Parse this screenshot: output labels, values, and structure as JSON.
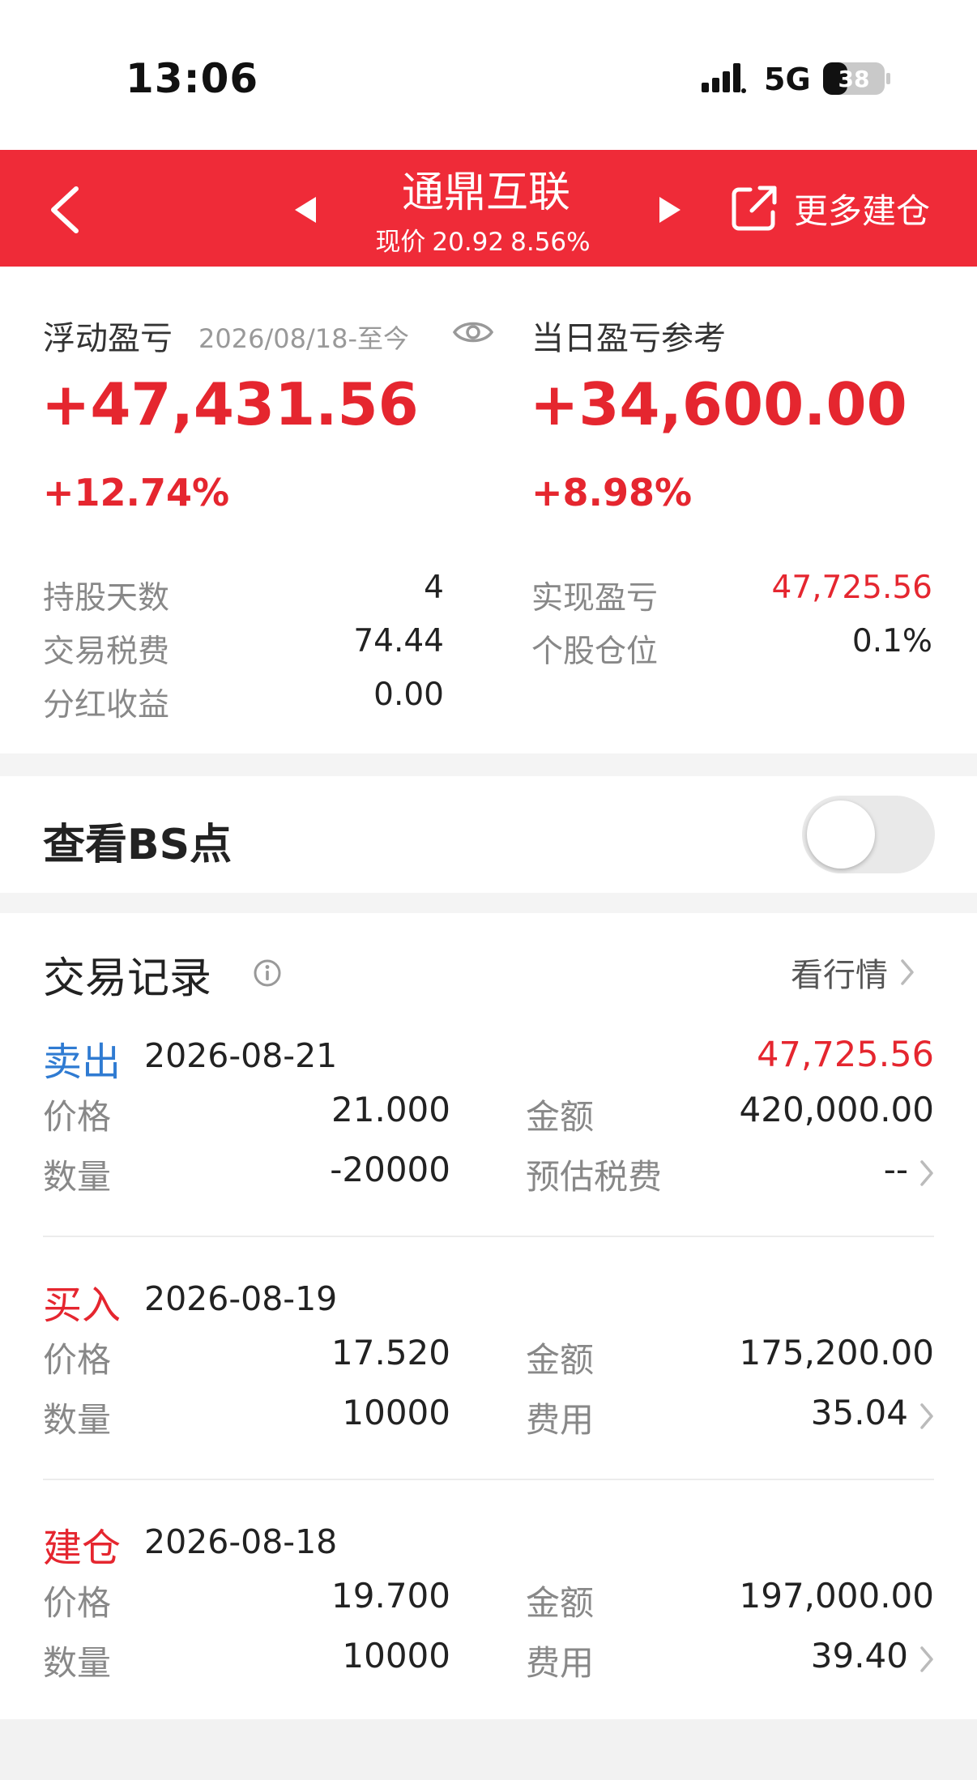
{
  "status_bar": {
    "time": "13:06",
    "network": "5G",
    "battery": "38"
  },
  "header": {
    "title": "通鼎互联",
    "price_label": "现价",
    "price": "20.92",
    "change_pct": "8.56%",
    "more_build_label": "更多建仓",
    "color": "#ef2b38"
  },
  "summary": {
    "floating": {
      "label": "浮动盈亏",
      "date_range": "2026/08/18-至今",
      "amount": "+47,431.56",
      "pct": "+12.74%"
    },
    "daily": {
      "label": "当日盈亏参考",
      "amount": "+34,600.00",
      "pct": "+8.98%"
    },
    "left_items": [
      {
        "label": "持股天数",
        "value": "4"
      },
      {
        "label": "交易税费",
        "value": "74.44"
      },
      {
        "label": "分红收益",
        "value": "0.00"
      }
    ],
    "right_items": [
      {
        "label": "实现盈亏",
        "value": "47,725.56"
      },
      {
        "label": "个股仓位",
        "value": "0.1%"
      }
    ]
  },
  "bs": {
    "label": "查看BS点",
    "enabled": false
  },
  "records": {
    "title": "交易记录",
    "view_market_label": "看行情",
    "items": [
      {
        "type": "卖出",
        "type_color": "#2f7bd2",
        "date": "2026-08-21",
        "profit": "47,725.56",
        "price_label": "价格",
        "price": "21.000",
        "amount_label": "金额",
        "amount": "420,000.00",
        "qty_label": "数量",
        "qty": "-20000",
        "fee_label": "预估税费",
        "fee": "--"
      },
      {
        "type": "买入",
        "type_color": "#e5262f",
        "date": "2026-08-19",
        "profit": "",
        "price_label": "价格",
        "price": "17.520",
        "amount_label": "金额",
        "amount": "175,200.00",
        "qty_label": "数量",
        "qty": "10000",
        "fee_label": "费用",
        "fee": "35.04"
      },
      {
        "type": "建仓",
        "type_color": "#e5262f",
        "date": "2026-08-18",
        "profit": "",
        "price_label": "价格",
        "price": "19.700",
        "amount_label": "金额",
        "amount": "197,000.00",
        "qty_label": "数量",
        "qty": "10000",
        "fee_label": "费用",
        "fee": "39.40"
      }
    ]
  }
}
